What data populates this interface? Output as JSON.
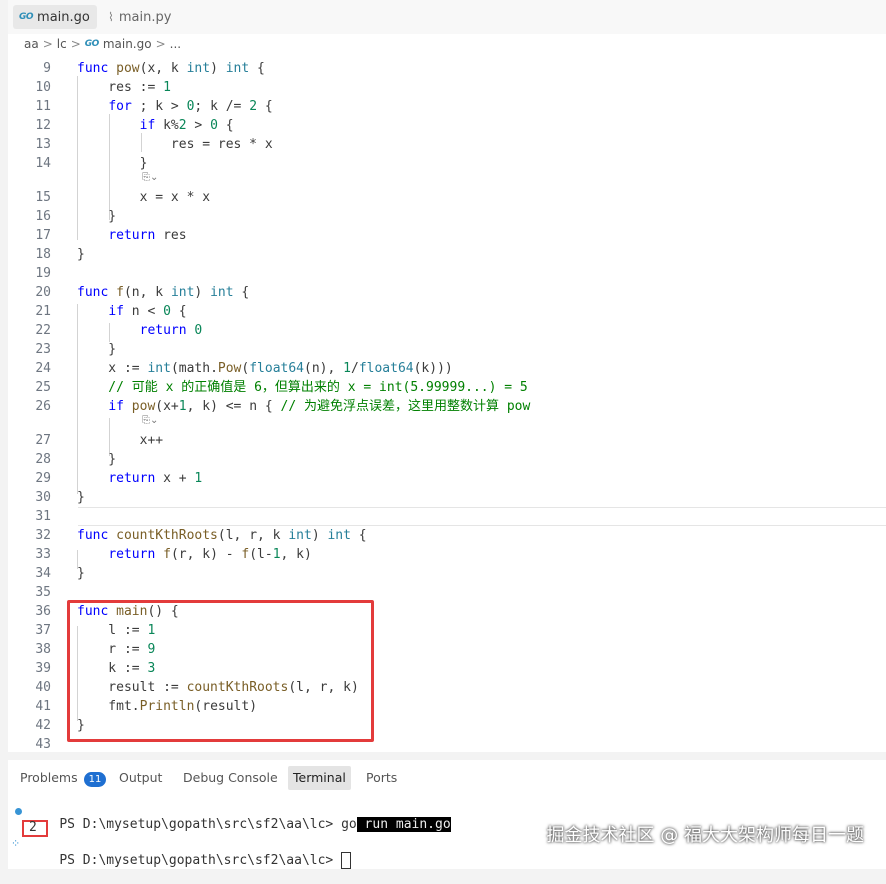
{
  "tabs": [
    {
      "icon": "go-file-icon",
      "logo": "GO",
      "label": "main.go",
      "active": true
    },
    {
      "icon": "python-file-icon",
      "label": "main.py",
      "active": false
    }
  ],
  "breadcrumb": {
    "parts": [
      "aa",
      "lc",
      "main.go",
      "..."
    ],
    "logo": "GO"
  },
  "code": {
    "l9": "9",
    "l10": "10",
    "l11": "11",
    "l12": "12",
    "l13": "13",
    "l14": "14",
    "l15": "15",
    "l16": "16",
    "l17": "17",
    "l18": "18",
    "l19": "19",
    "l20": "20",
    "l21": "21",
    "l22": "22",
    "l23": "23",
    "l24": "24",
    "l25": "25",
    "l26": "26",
    "l27": "27",
    "l28": "28",
    "l29": "29",
    "l30": "30",
    "l31": "31",
    "l32": "32",
    "l33": "33",
    "l34": "34",
    "l35": "35",
    "l36": "36",
    "l37": "37",
    "l38": "38",
    "l39": "39",
    "l40": "40",
    "l41": "41",
    "l42": "42",
    "l43": "43",
    "s9": "func pow(x, k int) int {",
    "s10": "    res := 1",
    "s11": "    for ; k > 0; k /= 2 {",
    "s12": "        if k%2 > 0 {",
    "s13": "            res = res * x",
    "s14": "        }",
    "s15": "        x = x * x",
    "s16": "    }",
    "s17": "    return res",
    "s18": "}",
    "s20": "func f(n, k int) int {",
    "s21": "    if n < 0 {",
    "s22": "        return 0",
    "s23": "    }",
    "s24": "    x := int(math.Pow(float64(n), 1/float64(k)))",
    "s25": "    // 可能 x 的正确值是 6，但算出来的 x = int(5.99999...) = 5",
    "s26": "    if pow(x+1, k) <= n { // 为避免浮点误差，这里用整数计算 pow",
    "s27": "        x++",
    "s28": "    }",
    "s29": "    return x + 1",
    "s30": "}",
    "s32": "func countKthRoots(l, r, k int) int {",
    "s33": "    return f(r, k) - f(l-1, k)",
    "s34": "}",
    "s36": "func main() {",
    "s37": "    l := 1",
    "s38": "    r := 9",
    "s39": "    k := 3",
    "s40": "    result := countKthRoots(l, r, k)",
    "s41": "    fmt.Println(result)",
    "s42": "}",
    "hint": "⎘⌄"
  },
  "panel": {
    "tabs": [
      "Problems",
      "Output",
      "Debug Console",
      "Terminal",
      "Ports"
    ],
    "problems_count": "11",
    "active_tab": "Terminal"
  },
  "terminal": {
    "prompt1": "PS D:\\mysetup\\gopath\\src\\sf2\\aa\\lc> ",
    "cmd_go": "go",
    "cmd_rest": " run main.go",
    "output": "2",
    "prompt2": "PS D:\\mysetup\\gopath\\src\\sf2\\aa\\lc> "
  },
  "watermark": "掘金技术社区 @ 福大大架构师每日一题",
  "colors": {
    "highlight": "#e33b3b",
    "badge": "#1f6fd1",
    "keyword": "#0000ff",
    "comment": "#008000"
  }
}
